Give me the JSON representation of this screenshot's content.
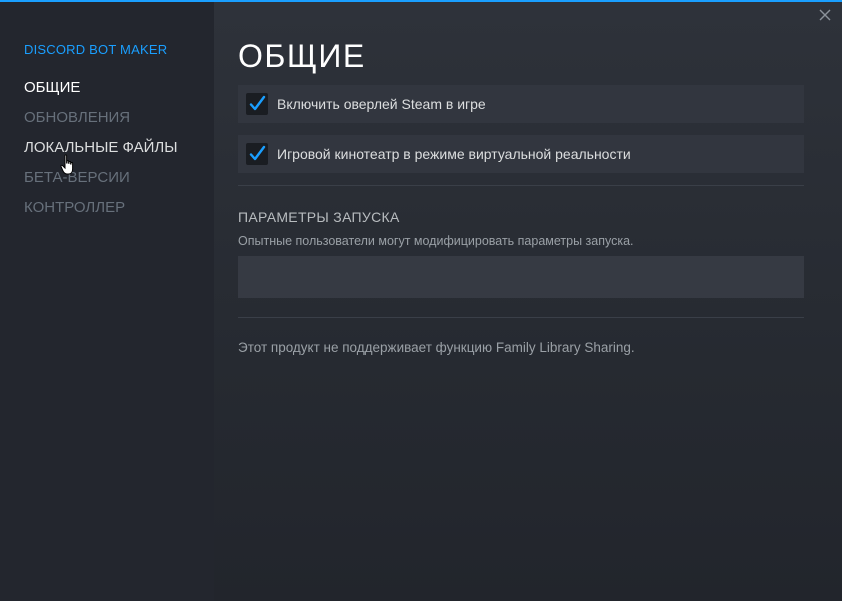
{
  "sidebar": {
    "app_title": "DISCORD BOT MAKER",
    "items": [
      {
        "label": "ОБЩИЕ",
        "state": "active"
      },
      {
        "label": "ОБНОВЛЕНИЯ",
        "state": "normal"
      },
      {
        "label": "ЛОКАЛЬНЫЕ ФАЙЛЫ",
        "state": "hover"
      },
      {
        "label": "БЕТА-ВЕРСИИ",
        "state": "normal"
      },
      {
        "label": "КОНТРОЛЛЕР",
        "state": "normal"
      }
    ]
  },
  "main": {
    "title": "ОБЩИЕ",
    "options": [
      {
        "label": "Включить оверлей Steam в игре",
        "checked": true
      },
      {
        "label": "Игровой кинотеатр в режиме виртуальной реальности",
        "checked": true
      }
    ],
    "launch": {
      "title": "ПАРАМЕТРЫ ЗАПУСКА",
      "description": "Опытные пользователи могут модифицировать параметры запуска.",
      "value": ""
    },
    "family_sharing_text": "Этот продукт не поддерживает функцию Family Library Sharing."
  },
  "icons": {
    "close": "close-icon",
    "checkbox": "checkmark-icon",
    "cursor": "hand-pointer-icon"
  },
  "colors": {
    "accent": "#1a9fff",
    "background": "#23262e",
    "panel": "#32363f"
  }
}
